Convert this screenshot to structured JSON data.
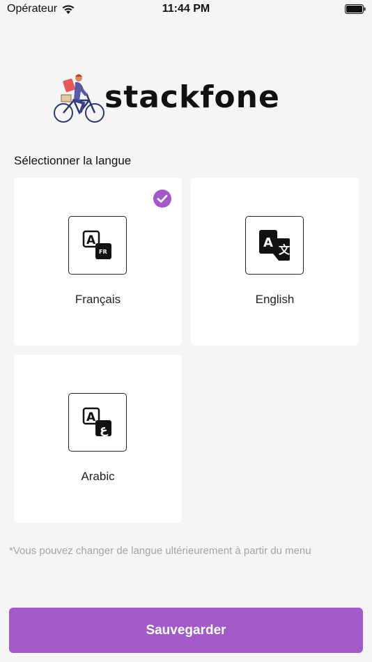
{
  "status_bar": {
    "carrier": "Opérateur",
    "time": "11:44 PM"
  },
  "logo": {
    "text": "stackfone",
    "icon": "delivery-rider-icon"
  },
  "section_title": "Sélectionner la langue",
  "languages": [
    {
      "label": "Français",
      "icon": "translate-fr-icon",
      "selected": true
    },
    {
      "label": "English",
      "icon": "translate-icon",
      "selected": false
    },
    {
      "label": "Arabic",
      "icon": "translate-ar-icon",
      "selected": false
    }
  ],
  "hint": "*Vous pouvez changer de langue ultérieurement à partir du menu",
  "save_label": "Sauvegarder",
  "colors": {
    "accent": "#a25ac9",
    "background": "#f5f5f5",
    "card": "#ffffff",
    "hint_text": "#a5a5a5"
  }
}
